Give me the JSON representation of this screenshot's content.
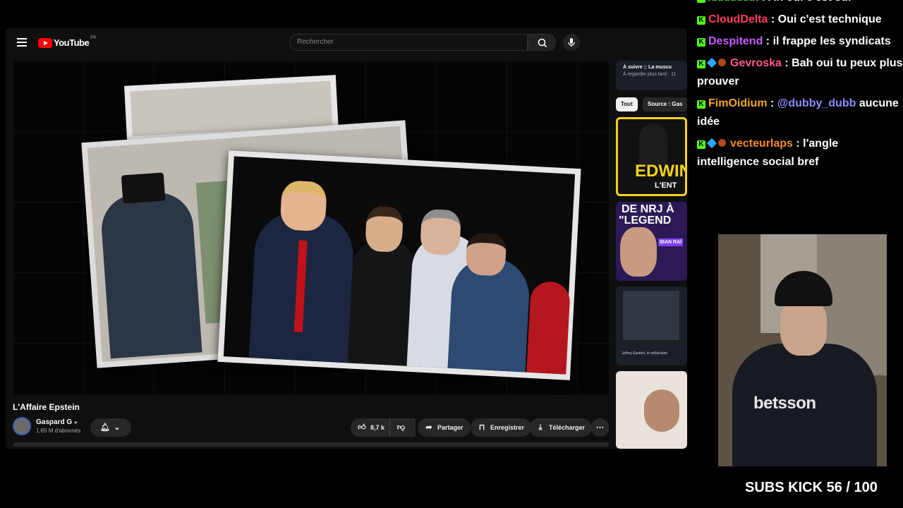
{
  "youtube": {
    "logo_text": "YouTube",
    "logo_region": "FR",
    "search_placeholder": "Rechercher",
    "video_title": "L'Affaire Epstein",
    "channel_name": "Gaspard G",
    "channel_subs": "1,65 M d'abonnés",
    "likes": "8,7 k",
    "share": "Partager",
    "save": "Enregistrer",
    "download": "Télécharger",
    "up_next": "À suivre :: La muscu",
    "up_next_sub": "À regarder plus tard · 11",
    "chips": [
      "Tout",
      "Source : Gas"
    ],
    "thumb_texts": [
      "EDWIN",
      "L'ENT",
      "DE NRJ À",
      "\"LEGEND",
      "IBAN RAÏ",
      "Jeffrey Epstein, le milliardaire"
    ]
  },
  "chat": [
    {
      "user": "xxxxxxxx",
      "color": "#53fc18",
      "text": "Ah oui c'est sur",
      "badges": [
        "kick"
      ]
    },
    {
      "user": "CloudDelta",
      "color": "#ff3f5a",
      "text": "Oui c'est technique",
      "badges": [
        "kick"
      ]
    },
    {
      "user": "Despitend",
      "color": "#c55cf8",
      "text": "il frappe les syndicats",
      "badges": [
        "kick"
      ]
    },
    {
      "user": "Gevroska",
      "color": "#ff5a86",
      "text": "Bah oui tu peux plus prouver",
      "badges": [
        "kick",
        "cube",
        "ball"
      ]
    },
    {
      "user": "FimOidium",
      "color": "#f5a623",
      "mention": "@dubby_dubb",
      "mention_color": "#8a8cff",
      "text": "aucune idée",
      "badges": [
        "kick"
      ]
    },
    {
      "user": "vecteurlaps",
      "color": "#f58a1f",
      "text": "l'angle intelligence social bref",
      "badges": [
        "kick",
        "cube",
        "ball"
      ]
    }
  ],
  "webcam": {
    "shirt_text": "betsson"
  },
  "sub_goal": "SUBS KICK 56 / 100"
}
